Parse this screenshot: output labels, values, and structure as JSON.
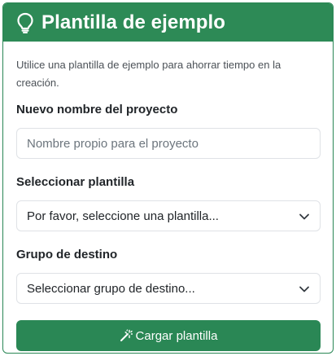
{
  "header": {
    "title": "Plantilla de ejemplo",
    "icon": "lightbulb-icon"
  },
  "intro_text": "Utilice una plantilla de ejemplo para ahorrar tiempo en la creación.",
  "project_name": {
    "label": "Nuevo nombre del proyecto",
    "placeholder": "Nombre propio para el proyecto",
    "value": ""
  },
  "template_select": {
    "label": "Seleccionar plantilla",
    "selected": "Por favor, seleccione una plantilla..."
  },
  "group_select": {
    "label": "Grupo de destino",
    "selected": "Seleccionar grupo de destino..."
  },
  "load_button": {
    "label": "Cargar plantilla",
    "icon": "magic-wand-icon"
  },
  "colors": {
    "primary": "#2d8a56",
    "border": "#dfe2e6"
  }
}
